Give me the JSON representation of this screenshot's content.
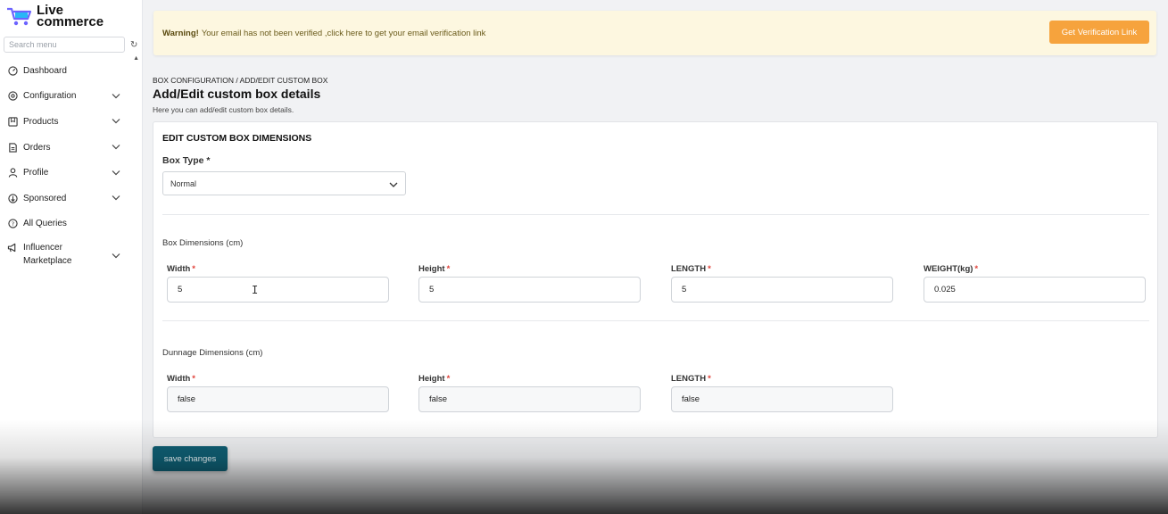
{
  "brand": {
    "line1": "Live",
    "line2": "commerce",
    "colors": {
      "cart": "#6c63ff",
      "accent": "#29b6f6"
    }
  },
  "sidebar": {
    "search_placeholder": "Search menu",
    "items": [
      {
        "label": "Dashboard",
        "icon": "dashboard-icon",
        "expandable": false
      },
      {
        "label": "Configuration",
        "icon": "gear-icon",
        "expandable": true
      },
      {
        "label": "Products",
        "icon": "box-icon",
        "expandable": true
      },
      {
        "label": "Orders",
        "icon": "document-icon",
        "expandable": true
      },
      {
        "label": "Profile",
        "icon": "user-icon",
        "expandable": true
      },
      {
        "label": "Sponsored",
        "icon": "sponsored-icon",
        "expandable": true
      },
      {
        "label": "All Queries",
        "icon": "question-icon",
        "expandable": false
      },
      {
        "label_line1": "Influencer",
        "label_line2": "Marketplace",
        "icon": "megaphone-icon",
        "expandable": true
      }
    ]
  },
  "banner": {
    "warning_strong": "Warning!",
    "warning_text": "Your email has not been verified ,click here to get your email verification link",
    "button_label": "Get Verification Link",
    "bg_color": "#fdf7e0",
    "button_color": "#f6a33d"
  },
  "page": {
    "breadcrumb": "BOX CONFIGURATION / ADD/EDIT CUSTOM BOX",
    "title": "Add/Edit custom box details",
    "subtitle": "Here you can add/edit custom box details."
  },
  "form": {
    "card_title": "EDIT CUSTOM BOX DIMENSIONS",
    "box_type_label": "Box Type",
    "box_type_value": "Normal",
    "required_mark": "*",
    "box_dimensions": {
      "section_label": "Box Dimensions (cm)",
      "fields": [
        {
          "label": "Width",
          "value": "5"
        },
        {
          "label": "Height",
          "value": "5"
        },
        {
          "label": "LENGTH",
          "value": "5"
        },
        {
          "label": "WEIGHT(kg)",
          "value": "0.025"
        }
      ]
    },
    "dunnage_dimensions": {
      "section_label": "Dunnage Dimensions (cm)",
      "fields": [
        {
          "label": "Width",
          "value": "false"
        },
        {
          "label": "Height",
          "value": "false"
        },
        {
          "label": "LENGTH",
          "value": "false"
        }
      ]
    },
    "save_label": "save changes",
    "save_color": "#0f5f74"
  }
}
